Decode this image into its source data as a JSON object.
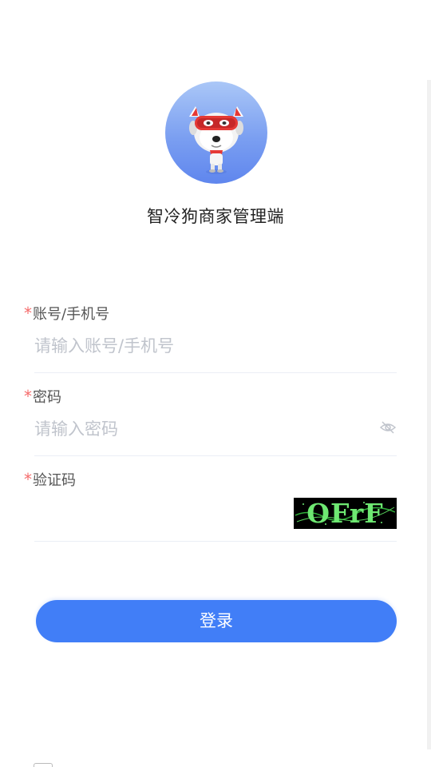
{
  "app": {
    "title": "智冷狗商家管理端",
    "logo_icon": "robot-dog-mascot-icon"
  },
  "form": {
    "account": {
      "required_mark": "*",
      "label": "账号/手机号",
      "placeholder": "请输入账号/手机号",
      "value": ""
    },
    "password": {
      "required_mark": "*",
      "label": "密码",
      "placeholder": "请输入密码",
      "value": "",
      "toggle_icon": "eye-off-icon"
    },
    "captcha": {
      "required_mark": "*",
      "label": "验证码",
      "value": "",
      "image_text": "OFrF"
    },
    "submit_label": "登录"
  },
  "colors": {
    "primary": "#417ef7",
    "required": "#f56c6c",
    "captcha_bg": "#000000",
    "captcha_text": "#6ee872"
  }
}
